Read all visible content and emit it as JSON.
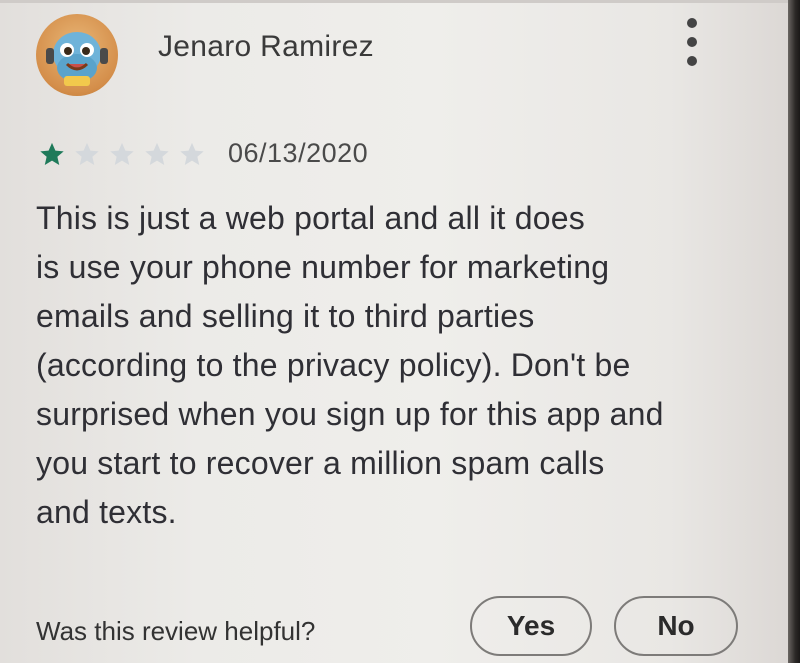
{
  "review": {
    "reviewer_name": "Jenaro Ramirez",
    "rating": 1,
    "rating_max": 5,
    "date": "06/13/2020",
    "text_lines": [
      "This is just a web portal and all it does",
      "is use your phone number for marketing",
      "emails and selling it to third parties",
      "(according to the privacy policy). Don't be",
      "surprised when you sign up for this app and",
      "you start to recover a million spam calls",
      "and texts."
    ]
  },
  "helpful": {
    "question": "Was this review helpful?",
    "yes_label": "Yes",
    "no_label": "No"
  },
  "colors": {
    "star_filled": "#1f7a5a",
    "star_empty": "#d4d8dc",
    "text": "#2f2f35"
  },
  "icons": {
    "avatar": "avatar-icon",
    "more": "more-vert-icon",
    "star": "star-icon"
  }
}
